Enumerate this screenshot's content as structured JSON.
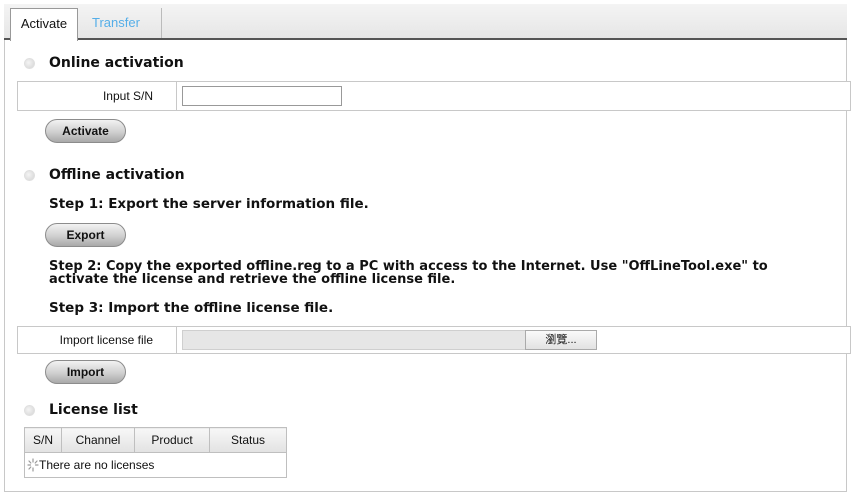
{
  "tabs": [
    {
      "label": "Activate",
      "active": true
    },
    {
      "label": "Transfer",
      "active": false
    }
  ],
  "online": {
    "title": "Online activation",
    "input_label": "Input S/N",
    "input_value": "",
    "button": "Activate"
  },
  "offline": {
    "title": "Offline activation",
    "step1": "Step 1: Export the server information file.",
    "export_button": "Export",
    "step2": "Step 2: Copy the exported offline.reg to a PC with access to the Internet. Use \"OffLineTool.exe\" to activate the license and retrieve the offline license file.",
    "step3": "Step 3: Import the offline license file.",
    "import_label": "Import license file",
    "browse_button": "瀏覽...",
    "import_button": "Import"
  },
  "license_list": {
    "title": "License list",
    "columns": [
      "S/N",
      "Channel",
      "Product",
      "Status"
    ],
    "empty_text": "There are no licenses"
  },
  "colors": {
    "accent_tab_text": "#55aee8",
    "tab_border": "#555555",
    "button_gray": "#cfcfcf"
  }
}
